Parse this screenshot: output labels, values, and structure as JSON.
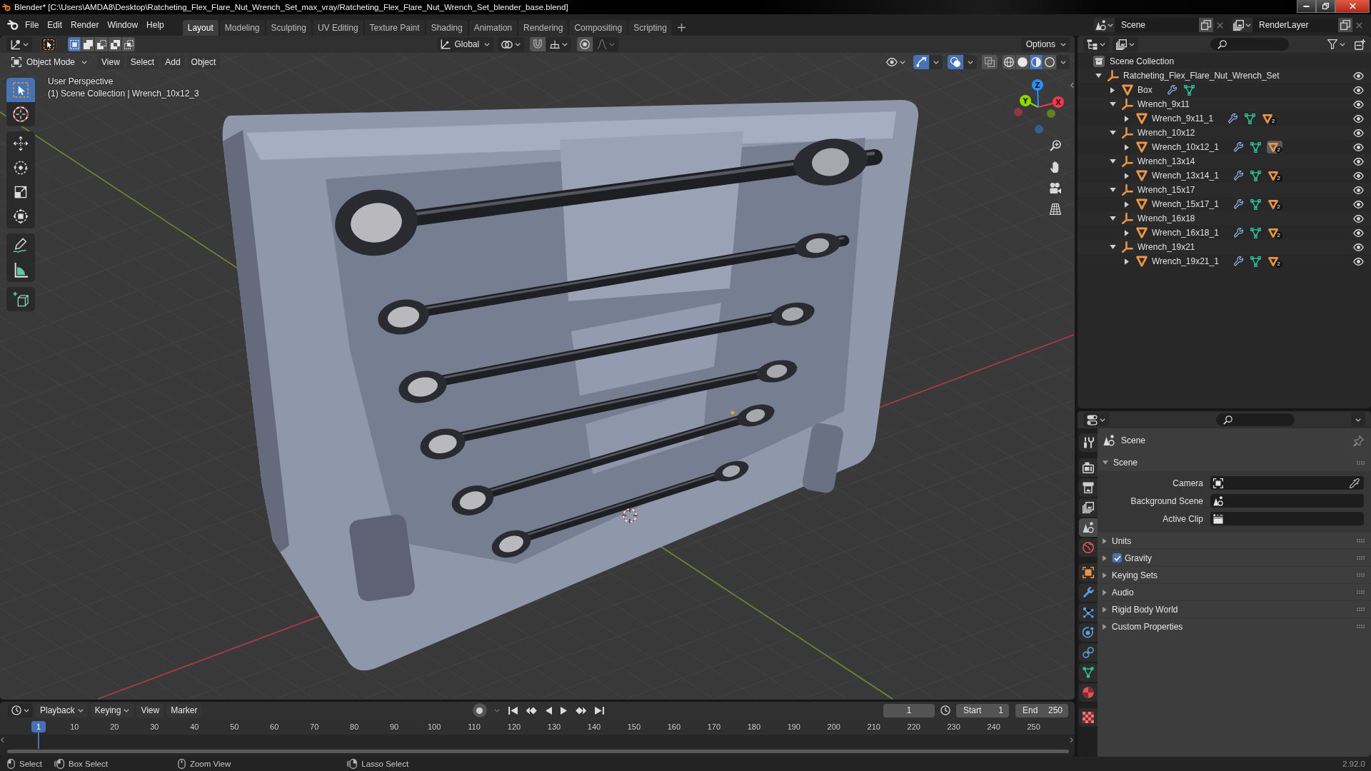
{
  "title_bar": {
    "title": "Blender* [C:\\Users\\AMDA8\\Desktop\\Ratcheting_Flex_Flare_Nut_Wrench_Set_max_vray/Ratcheting_Flex_Flare_Nut_Wrench_Set_blender_base.blend]"
  },
  "top_bar": {
    "menus": [
      "File",
      "Edit",
      "Render",
      "Window",
      "Help"
    ],
    "workspaces": [
      {
        "label": "Layout",
        "selected": true
      },
      {
        "label": "Modeling",
        "selected": false
      },
      {
        "label": "Sculpting",
        "selected": false
      },
      {
        "label": "UV Editing",
        "selected": false
      },
      {
        "label": "Texture Paint",
        "selected": false
      },
      {
        "label": "Shading",
        "selected": false
      },
      {
        "label": "Animation",
        "selected": false
      },
      {
        "label": "Rendering",
        "selected": false
      },
      {
        "label": "Compositing",
        "selected": false
      },
      {
        "label": "Scripting",
        "selected": false
      }
    ],
    "scene": "Scene",
    "view_layer": "RenderLayer"
  },
  "viewport": {
    "tool_header": {
      "select_modes": [
        {
          "kind": "set",
          "selected": true
        },
        {
          "kind": "extend",
          "selected": false
        },
        {
          "kind": "subtract",
          "selected": false
        },
        {
          "kind": "difference",
          "selected": false
        },
        {
          "kind": "intersect",
          "selected": false
        }
      ],
      "orientation": "Global",
      "snap": {
        "on": false
      },
      "proportional": {
        "on": false
      },
      "options": "Options"
    },
    "header": {
      "mode": "Object Mode",
      "menus": [
        "View",
        "Select",
        "Add",
        "Object"
      ],
      "toggles": [
        {
          "kind": "gizmos",
          "on": true
        },
        {
          "kind": "overlays",
          "on": true
        },
        {
          "kind": "xray",
          "on": false
        }
      ],
      "shading": [
        {
          "kind": "wireframe",
          "selected": false
        },
        {
          "kind": "solid",
          "selected": false
        },
        {
          "kind": "material",
          "selected": true
        },
        {
          "kind": "rendered",
          "selected": false
        }
      ]
    },
    "tool_groups": [
      [
        {
          "kind": "select_box",
          "selected": true
        },
        {
          "kind": "cursor",
          "selected": false
        }
      ],
      [
        {
          "kind": "move",
          "selected": false
        },
        {
          "kind": "rotate",
          "selected": false
        },
        {
          "kind": "scale",
          "selected": false
        },
        {
          "kind": "transform",
          "selected": false
        }
      ],
      [
        {
          "kind": "annotate",
          "selected": false
        },
        {
          "kind": "measure",
          "selected": false
        }
      ],
      [
        {
          "kind": "add_cube",
          "selected": false
        }
      ]
    ],
    "view_name": "User Perspective",
    "context": "(1) Scene Collection | Wrench_10x12_3",
    "gizmo_axes": [
      {
        "label": "X",
        "color": "#ff3352"
      },
      {
        "label": "Y",
        "color": "#8bdc00"
      },
      {
        "label": "Z",
        "color": "#2890ff"
      }
    ]
  },
  "outliner": {
    "root": "Scene Collection",
    "items": [
      {
        "kind": "empty",
        "label": "Ratcheting_Flex_Flare_Nut_Wrench_Set",
        "expanded": true,
        "selected": false,
        "visible": true,
        "children": [
          {
            "kind": "mesh",
            "label": "Box",
            "expanded": false,
            "selected": false,
            "visible": true,
            "extras": [
              {
                "kind": "modifier"
              },
              {
                "kind": "mesh_data"
              }
            ]
          },
          {
            "kind": "empty",
            "label": "Wrench_9x11",
            "expanded": true,
            "selected": false,
            "visible": true,
            "children": [
              {
                "kind": "mesh",
                "label": "Wrench_9x11_1",
                "expanded": false,
                "selected": false,
                "visible": true,
                "extras": [
                  {
                    "kind": "modifier"
                  },
                  {
                    "kind": "mesh_data"
                  },
                  {
                    "kind": "children",
                    "count": "2",
                    "selected": false
                  }
                ]
              }
            ]
          },
          {
            "kind": "empty",
            "label": "Wrench_10x12",
            "expanded": true,
            "selected": false,
            "visible": true,
            "children": [
              {
                "kind": "mesh",
                "label": "Wrench_10x12_1",
                "expanded": false,
                "selected": false,
                "visible": true,
                "extras": [
                  {
                    "kind": "modifier"
                  },
                  {
                    "kind": "mesh_data"
                  },
                  {
                    "kind": "children",
                    "count": "2",
                    "selected": true
                  }
                ]
              }
            ]
          },
          {
            "kind": "empty",
            "label": "Wrench_13x14",
            "expanded": true,
            "selected": false,
            "visible": true,
            "children": [
              {
                "kind": "mesh",
                "label": "Wrench_13x14_1",
                "expanded": false,
                "selected": false,
                "visible": true,
                "extras": [
                  {
                    "kind": "modifier"
                  },
                  {
                    "kind": "mesh_data"
                  },
                  {
                    "kind": "children",
                    "count": "2",
                    "selected": false
                  }
                ]
              }
            ]
          },
          {
            "kind": "empty",
            "label": "Wrench_15x17",
            "expanded": true,
            "selected": false,
            "visible": true,
            "children": [
              {
                "kind": "mesh",
                "label": "Wrench_15x17_1",
                "expanded": false,
                "selected": false,
                "visible": true,
                "extras": [
                  {
                    "kind": "modifier"
                  },
                  {
                    "kind": "mesh_data"
                  },
                  {
                    "kind": "children",
                    "count": "2",
                    "selected": false
                  }
                ]
              }
            ]
          },
          {
            "kind": "empty",
            "label": "Wrench_16x18",
            "expanded": true,
            "selected": false,
            "visible": true,
            "children": [
              {
                "kind": "mesh",
                "label": "Wrench_16x18_1",
                "expanded": false,
                "selected": false,
                "visible": true,
                "extras": [
                  {
                    "kind": "modifier"
                  },
                  {
                    "kind": "mesh_data"
                  },
                  {
                    "kind": "children",
                    "count": "2",
                    "selected": false
                  }
                ]
              }
            ]
          },
          {
            "kind": "empty",
            "label": "Wrench_19x21",
            "expanded": true,
            "selected": false,
            "visible": true,
            "children": [
              {
                "kind": "mesh",
                "label": "Wrench_19x21_1",
                "expanded": false,
                "selected": false,
                "visible": true,
                "extras": [
                  {
                    "kind": "modifier"
                  },
                  {
                    "kind": "mesh_data"
                  },
                  {
                    "kind": "children",
                    "count": "2",
                    "selected": false
                  }
                ]
              }
            ]
          }
        ]
      }
    ]
  },
  "properties": {
    "tab_groups": [
      [
        {
          "kind": "tool",
          "selected": false
        }
      ],
      [
        {
          "kind": "render",
          "selected": false
        },
        {
          "kind": "output",
          "selected": false
        },
        {
          "kind": "view_layer",
          "selected": false
        },
        {
          "kind": "scene",
          "selected": true
        },
        {
          "kind": "world",
          "selected": false
        }
      ],
      [
        {
          "kind": "object",
          "selected": false
        },
        {
          "kind": "modifiers",
          "selected": false
        },
        {
          "kind": "particles",
          "selected": false
        },
        {
          "kind": "physics",
          "selected": false
        },
        {
          "kind": "constraints",
          "selected": false
        },
        {
          "kind": "data",
          "selected": false
        },
        {
          "kind": "material",
          "selected": false
        }
      ],
      [
        {
          "kind": "texture",
          "selected": false
        }
      ]
    ],
    "context": "Scene",
    "panel": {
      "title": "Scene",
      "expanded": true,
      "fields": [
        {
          "kind": "camera",
          "label": "Camera"
        },
        {
          "kind": "scene",
          "label": "Background Scene"
        },
        {
          "kind": "clip",
          "label": "Active Clip"
        }
      ]
    },
    "subpanels": [
      {
        "kind": "plain",
        "label": "Units",
        "expanded": false
      },
      {
        "kind": "checkbox",
        "label": "Gravity",
        "expanded": false,
        "checked": true
      },
      {
        "kind": "plain",
        "label": "Keying Sets",
        "expanded": false
      },
      {
        "kind": "plain",
        "label": "Audio",
        "expanded": false
      },
      {
        "kind": "plain",
        "label": "Rigid Body World",
        "expanded": false
      },
      {
        "kind": "plain",
        "label": "Custom Properties",
        "expanded": false
      }
    ]
  },
  "timeline": {
    "menus": [
      {
        "label": "Playback",
        "dropdown": true
      },
      {
        "label": "Keying",
        "dropdown": true
      },
      {
        "label": "View",
        "dropdown": false
      },
      {
        "label": "Marker",
        "dropdown": false
      }
    ],
    "auto_keying": {
      "on": false
    },
    "current_frame": "1",
    "start_label": "Start",
    "start": "1",
    "end_label": "End",
    "end": "250",
    "playhead": "1",
    "ruler": [
      "10",
      "20",
      "30",
      "40",
      "50",
      "60",
      "70",
      "80",
      "90",
      "100",
      "110",
      "120",
      "130",
      "140",
      "150",
      "160",
      "170",
      "180",
      "190",
      "200",
      "210",
      "220",
      "230",
      "240",
      "250"
    ]
  },
  "status_bar": {
    "hints": [
      {
        "kind": "left",
        "label": "Select"
      },
      {
        "kind": "left_drag",
        "label": "Box Select"
      },
      {
        "kind": "middle",
        "label": "Zoom View"
      },
      {
        "kind": "right_drag",
        "label": "Lasso Select"
      }
    ],
    "version": "2.92.0"
  }
}
